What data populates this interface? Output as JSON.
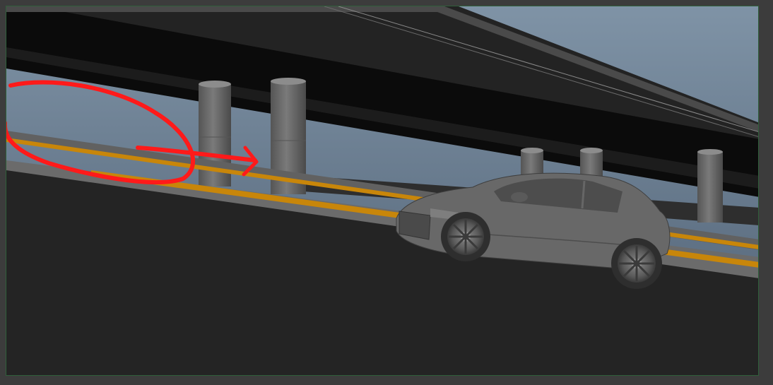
{
  "app": {
    "window": "3D viewport",
    "view": "perspective"
  },
  "scene": {
    "sky_top": "#6f8396",
    "sky_bottom": "#56687b",
    "ground": "#252525",
    "overpass": "#0c0c0c",
    "guard_rail": "#5e5e5e",
    "stripe": "#c8860a",
    "pillar": "#6c6c6c",
    "car_body": "#6a6a6a"
  },
  "annotation": {
    "color": "#ff1a1a",
    "shapes": [
      "circle-mark",
      "arrow-mark"
    ]
  },
  "icons": [
    "pillar-object",
    "car-model-object"
  ]
}
